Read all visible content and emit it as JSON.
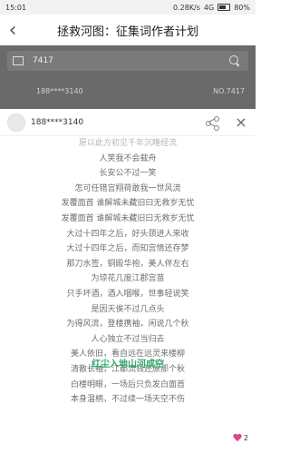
{
  "status": {
    "time": "15:01",
    "network": "0.28K/s",
    "signal": "4G",
    "battery": "80%"
  },
  "nav": {
    "back_glyph": "‹",
    "title": "拯救河图：征集词作者计划"
  },
  "search": {
    "query": "7417"
  },
  "result": {
    "user": "188****3140",
    "id": "NO.7417"
  },
  "card": {
    "user": "188****3140",
    "close_glyph": "×"
  },
  "lyrics": [
    "愿以此方初见千年沉睡经流",
    "人笑我不会载舟",
    "长安公不过一笑",
    "怎可任错宫翔荷敢我一世风流",
    "发覆面首 谁解城未藏旧曰无救岁无忧",
    "发覆面首 谁解城未藏旧曰无救岁无忧",
    "大过十四年之后，好头颈进人来收",
    "大过十四年之后，而知宫情还存梦",
    "那刀水签，铜殿华袍，美人伴左右",
    "为琼花几度江郡宫苗",
    "只手坏酒，酒入咽喉，世事轻说笑",
    "是因天俟不过几点头",
    "为得风流，登楼携袖，闲说几个秋",
    "人心独立不过当归去",
    "美人依旧，看自远在远灵来楼柳",
    "清散长袖，江都流钱还原那个秋",
    "白楼明眼，一场后只负发白面首",
    "本身温柄，不过续一场天空不伤"
  ],
  "floating_title": "红尘入地山河成空",
  "likes": {
    "count": "2"
  }
}
